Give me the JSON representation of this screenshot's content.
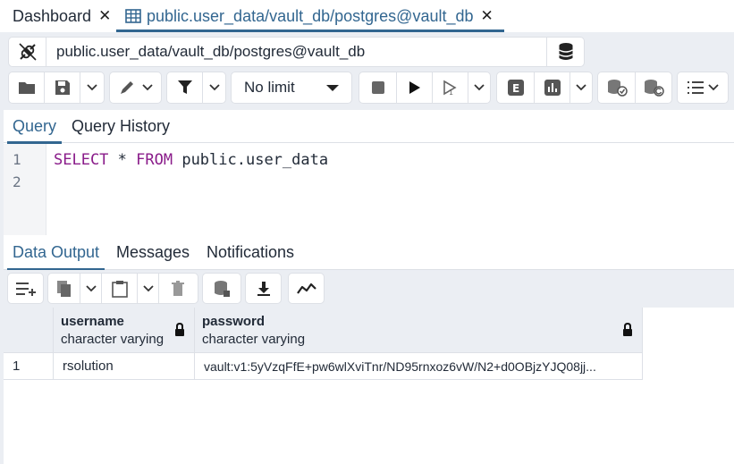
{
  "tabs": {
    "dashboard": "Dashboard",
    "query_tab": "public.user_data/vault_db/postgres@vault_db",
    "close_glyph": "✕"
  },
  "connection": {
    "label": "public.user_data/vault_db/postgres@vault_db"
  },
  "toolbar": {
    "limit_value": "No limit",
    "icons": [
      "folder-icon",
      "save-icon",
      "chevron-down-icon",
      "edit-icon",
      "chevron-down-icon",
      "filter-icon",
      "chevron-down-icon",
      "stop-icon",
      "execute-icon",
      "execute-script-icon",
      "chevron-down-icon",
      "explain-icon",
      "explain-analyze-icon",
      "chevron-down-icon",
      "commit-icon",
      "rollback-icon",
      "macros-icon"
    ]
  },
  "query_panel": {
    "tabs": [
      "Query",
      "Query History"
    ],
    "line_numbers": [
      "1",
      "2"
    ],
    "sql": {
      "kw1": "SELECT",
      "star": " * ",
      "kw2": "FROM",
      "rest": " public.user_data"
    }
  },
  "output_panel": {
    "tabs": [
      "Data Output",
      "Messages",
      "Notifications"
    ],
    "columns": [
      {
        "name": "username",
        "type": "character varying"
      },
      {
        "name": "password",
        "type": "character varying"
      }
    ],
    "rows": [
      {
        "num": "1",
        "cells": [
          "rsolution",
          "vault:v1:5yVzqFfE+pw6wlXviTnr/ND95rnxoz6vW/N2+d0OBjzYJQ08jj..."
        ]
      }
    ]
  },
  "colors": {
    "accent": "#326690",
    "keyword": "#8a1c8a",
    "panel_bg": "#ebeef3"
  }
}
